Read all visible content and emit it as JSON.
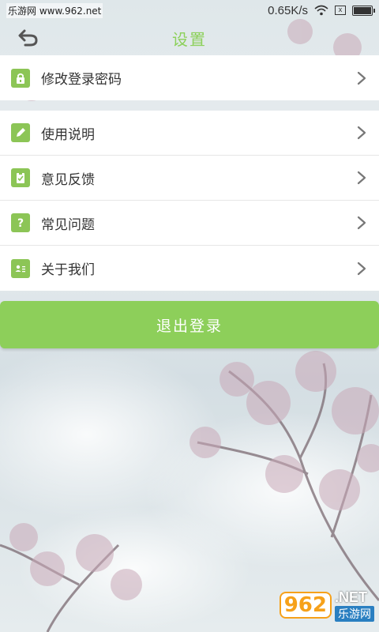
{
  "status_bar": {
    "site_text": "乐游网 www.962.net",
    "network_speed": "0.65K/s",
    "sim_label": "x",
    "battery_level": 0.9
  },
  "header": {
    "title": "设置",
    "back_icon": "back-arrow-icon"
  },
  "settings": {
    "group1": [
      {
        "label": "修改登录密码",
        "icon": "lock-icon"
      }
    ],
    "group2": [
      {
        "label": "使用说明",
        "icon": "pencil-icon"
      },
      {
        "label": "意见反馈",
        "icon": "clipboard-check-icon"
      },
      {
        "label": "常见问题",
        "icon": "question-icon"
      },
      {
        "label": "关于我们",
        "icon": "contact-card-icon"
      }
    ]
  },
  "logout_label": "退出登录",
  "watermark": {
    "number": "962",
    "suffix": ".NET",
    "chinese": "乐游网"
  },
  "colors": {
    "accent": "#8cd05a",
    "icon_bg": "#8cc556",
    "button": "#8dcf5a"
  }
}
